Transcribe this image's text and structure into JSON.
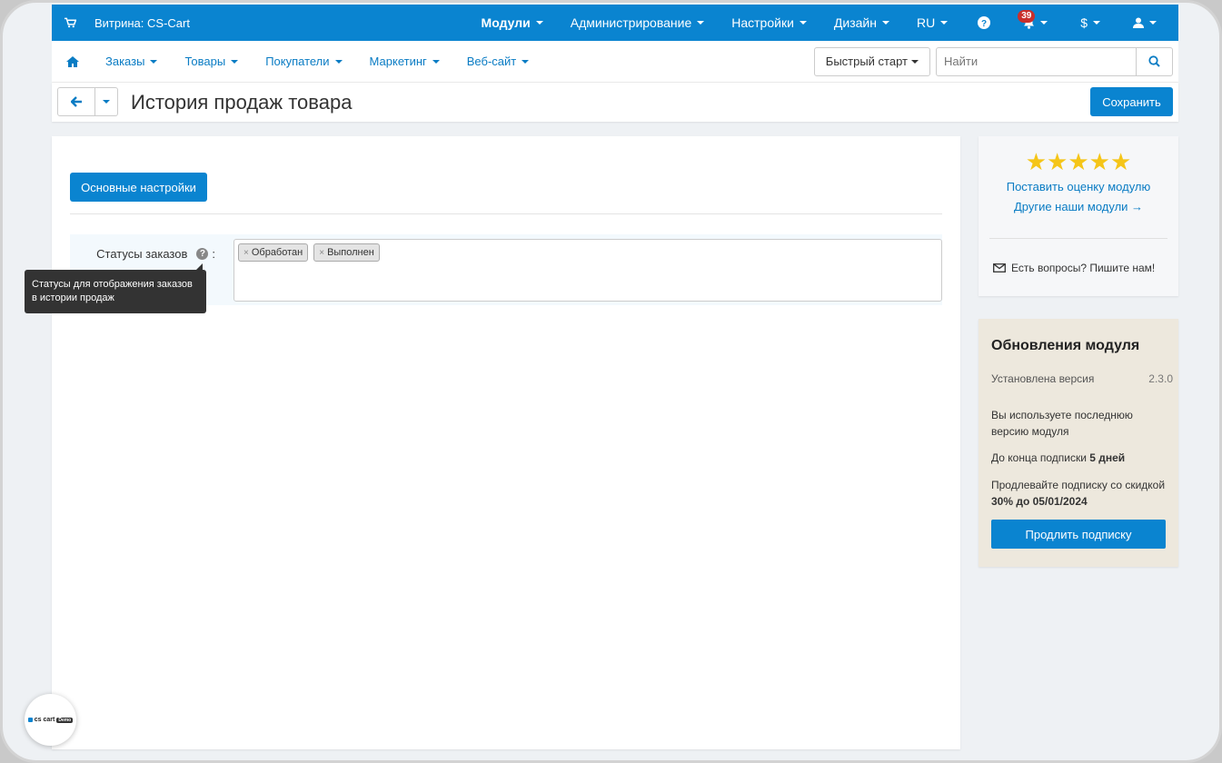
{
  "topbar": {
    "store_label": "Витрина: CS-Cart",
    "menu": [
      {
        "label": "Модули",
        "bold": true
      },
      {
        "label": "Администрирование"
      },
      {
        "label": "Настройки"
      },
      {
        "label": "Дизайн"
      },
      {
        "label": "RU"
      }
    ],
    "notifications_count": "39",
    "currency": "$",
    "cart_icon": "cart-icon",
    "help_icon": "question-circle-icon",
    "bell_icon": "bell-icon",
    "user_icon": "user-icon"
  },
  "subnav": {
    "home_icon": "home-icon",
    "items": [
      "Заказы",
      "Товары",
      "Покупатели",
      "Маркетинг",
      "Веб-сайт"
    ],
    "quick_start": "Быстрый старт",
    "search_placeholder": "Найти",
    "search_icon": "search-icon"
  },
  "titlebar": {
    "title": "История продаж товара",
    "save_label": "Сохранить",
    "back_icon": "arrow-left-icon"
  },
  "main": {
    "tab_label": "Основные настройки",
    "field_label": "Статусы заказов",
    "field_colon": ":",
    "tags": [
      "Обработан",
      "Выполнен"
    ],
    "tooltip": "Статусы для отображения заказов в истории продаж"
  },
  "sidebar": {
    "stars": "★★★★★",
    "rate_link": "Поставить оценку модулю",
    "others_link": "Другие наши модули →",
    "ask": "Есть вопросы? Пишите нам!",
    "updates_title": "Обновления модуля",
    "installed_label": "Установлена версия",
    "installed_version": "2.3.0",
    "latest_note": "Вы используете последнюю версию модуля",
    "sub_end_prefix": "До конца подписки ",
    "sub_end_value": "5 дней",
    "renew_prefix": "Продлевайте подписку со скидкой ",
    "renew_bold": "30% до 05/01/2024",
    "renew_button": "Продлить подписку"
  },
  "logo": {
    "text": "cs cart",
    "pill": "Demo"
  },
  "colors": {
    "primary": "#0a84d0",
    "link": "#0a7cc4",
    "star": "#f5c518",
    "updates_bg": "#ede8dd"
  }
}
